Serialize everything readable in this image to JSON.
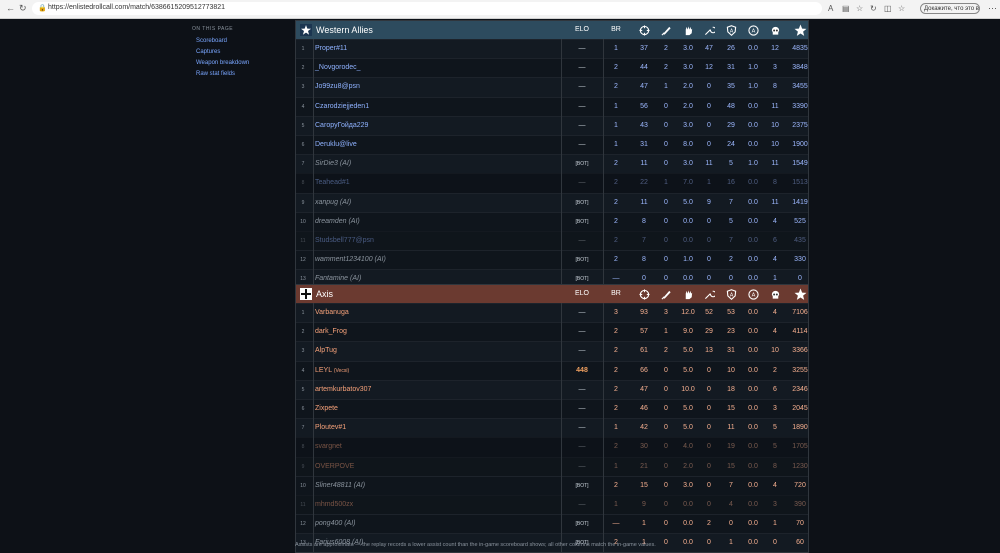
{
  "browser": {
    "url": "https://enlistedrollcall.com/match/6386615209512773821",
    "profile_label": "Докажите, что это вы"
  },
  "sidebar": {
    "heading": "ON THIS PAGE",
    "links": [
      "Scoreboard",
      "Captures",
      "Weapon breakdown",
      "Raw stat fields"
    ]
  },
  "columns": {
    "elo": "ELO",
    "br": "BR",
    "icons": [
      "crosshair-icon",
      "knife-icon",
      "glove-icon",
      "wrench-icon",
      "shield-a-icon",
      "circle-a-icon",
      "skull-icon",
      "star-icon"
    ]
  },
  "teams": [
    {
      "name": "Western Allies",
      "icon": "allied-star-icon",
      "color": "#2d4b5e",
      "rows": [
        {
          "n": "1",
          "player": "Proper#11",
          "elo": "—",
          "br": "1",
          "s": [
            "37",
            "2",
            "3.0",
            "47",
            "26",
            "0.0",
            "12",
            "4835"
          ]
        },
        {
          "n": "2",
          "player": "_Novgorodec_",
          "elo": "—",
          "br": "2",
          "s": [
            "44",
            "2",
            "3.0",
            "12",
            "31",
            "1.0",
            "3",
            "3848"
          ]
        },
        {
          "n": "3",
          "player": "Jo99zu8@psn",
          "elo": "—",
          "br": "2",
          "s": [
            "47",
            "1",
            "2.0",
            "0",
            "35",
            "1.0",
            "8",
            "3455"
          ]
        },
        {
          "n": "4",
          "player": "Czarodziejjeden1",
          "elo": "—",
          "br": "1",
          "s": [
            "56",
            "0",
            "2.0",
            "0",
            "48",
            "0.0",
            "11",
            "3390"
          ]
        },
        {
          "n": "5",
          "player": "CaгорyГойда229",
          "elo": "—",
          "br": "1",
          "s": [
            "43",
            "0",
            "3.0",
            "0",
            "29",
            "0.0",
            "10",
            "2375"
          ]
        },
        {
          "n": "6",
          "player": "Deruklu@live",
          "elo": "—",
          "br": "1",
          "s": [
            "31",
            "0",
            "8.0",
            "0",
            "24",
            "0.0",
            "10",
            "1900"
          ]
        },
        {
          "n": "7",
          "player": "SirDie3 (AI)",
          "ai": true,
          "elo": "[BOT]",
          "br": "2",
          "s": [
            "11",
            "0",
            "3.0",
            "11",
            "5",
            "1.0",
            "11",
            "1549"
          ]
        },
        {
          "n": "8",
          "player": "Teahead#1",
          "faded": true,
          "elo": "—",
          "br": "2",
          "s": [
            "22",
            "1",
            "7.0",
            "1",
            "16",
            "0.0",
            "8",
            "1513"
          ]
        },
        {
          "n": "9",
          "player": "xanpug (AI)",
          "ai": true,
          "elo": "[BOT]",
          "br": "2",
          "s": [
            "11",
            "0",
            "5.0",
            "9",
            "7",
            "0.0",
            "11",
            "1419"
          ]
        },
        {
          "n": "10",
          "player": "dreamden (AI)",
          "ai": true,
          "elo": "[BOT]",
          "br": "2",
          "s": [
            "8",
            "0",
            "0.0",
            "0",
            "5",
            "0.0",
            "4",
            "525"
          ]
        },
        {
          "n": "11",
          "player": "Studsbell777@psn",
          "faded": true,
          "elo": "—",
          "br": "2",
          "s": [
            "7",
            "0",
            "0.0",
            "0",
            "7",
            "0.0",
            "6",
            "435"
          ]
        },
        {
          "n": "12",
          "player": "wamment1234100 (AI)",
          "ai": true,
          "elo": "[BOT]",
          "br": "2",
          "s": [
            "8",
            "0",
            "1.0",
            "0",
            "2",
            "0.0",
            "4",
            "330"
          ]
        },
        {
          "n": "13",
          "player": "Fantamine (AI)",
          "ai": true,
          "elo": "[BOT]",
          "br": "—",
          "s": [
            "0",
            "0",
            "0.0",
            "0",
            "0",
            "0.0",
            "1",
            "0"
          ]
        }
      ]
    },
    {
      "name": "Axis",
      "icon": "iron-cross-icon",
      "color": "#6b3a30",
      "rows": [
        {
          "n": "1",
          "player": "Varbanuga",
          "elo": "—",
          "br": "3",
          "s": [
            "93",
            "3",
            "12.0",
            "52",
            "53",
            "0.0",
            "4",
            "7106"
          ]
        },
        {
          "n": "2",
          "player": "dark_Frog",
          "elo": "—",
          "br": "2",
          "s": [
            "57",
            "1",
            "9.0",
            "29",
            "23",
            "0.0",
            "4",
            "4114"
          ]
        },
        {
          "n": "3",
          "player": "AlpTug",
          "elo": "—",
          "br": "2",
          "s": [
            "61",
            "2",
            "5.0",
            "13",
            "31",
            "0.0",
            "10",
            "3366"
          ]
        },
        {
          "n": "4",
          "player": "LEYL",
          "tag": "(Vecsi)",
          "elo": "448",
          "br": "2",
          "s": [
            "66",
            "0",
            "5.0",
            "0",
            "10",
            "0.0",
            "2",
            "3255"
          ]
        },
        {
          "n": "5",
          "player": "artemkurbatov307",
          "elo": "—",
          "br": "2",
          "s": [
            "47",
            "0",
            "10.0",
            "0",
            "18",
            "0.0",
            "6",
            "2346"
          ]
        },
        {
          "n": "6",
          "player": "Zixpete",
          "elo": "—",
          "br": "2",
          "s": [
            "46",
            "0",
            "5.0",
            "0",
            "15",
            "0.0",
            "3",
            "2045"
          ]
        },
        {
          "n": "7",
          "player": "Ploutev#1",
          "elo": "—",
          "br": "1",
          "s": [
            "42",
            "0",
            "5.0",
            "0",
            "11",
            "0.0",
            "5",
            "1890"
          ]
        },
        {
          "n": "8",
          "player": "svargnet",
          "faded": true,
          "elo": "—",
          "br": "2",
          "s": [
            "30",
            "0",
            "4.0",
            "0",
            "19",
            "0.0",
            "5",
            "1705"
          ]
        },
        {
          "n": "9",
          "player": "OVERPOVE",
          "faded": true,
          "elo": "—",
          "br": "1",
          "s": [
            "21",
            "0",
            "2.0",
            "0",
            "15",
            "0.0",
            "8",
            "1230"
          ]
        },
        {
          "n": "10",
          "player": "Sliner48811 (AI)",
          "ai": true,
          "elo": "[BOT]",
          "br": "2",
          "s": [
            "15",
            "0",
            "3.0",
            "0",
            "7",
            "0.0",
            "4",
            "720"
          ]
        },
        {
          "n": "11",
          "player": "mhmd500zx",
          "faded": true,
          "elo": "—",
          "br": "1",
          "s": [
            "9",
            "0",
            "0.0",
            "0",
            "4",
            "0.0",
            "3",
            "390"
          ]
        },
        {
          "n": "12",
          "player": "pong400 (AI)",
          "ai": true,
          "elo": "[BOT]",
          "br": "—",
          "s": [
            "1",
            "0",
            "0.0",
            "2",
            "0",
            "0.0",
            "1",
            "70"
          ]
        },
        {
          "n": "13",
          "player": "Farius6008 (AI)",
          "ai": true,
          "elo": "[BOT]",
          "br": "2",
          "s": [
            "1",
            "0",
            "0.0",
            "0",
            "1",
            "0.0",
            "0",
            "60"
          ]
        }
      ]
    }
  ],
  "footnote": "Assists are approximate — the replay records a lower assist count than the in-game scoreboard shows; all other columns match the in-game values."
}
